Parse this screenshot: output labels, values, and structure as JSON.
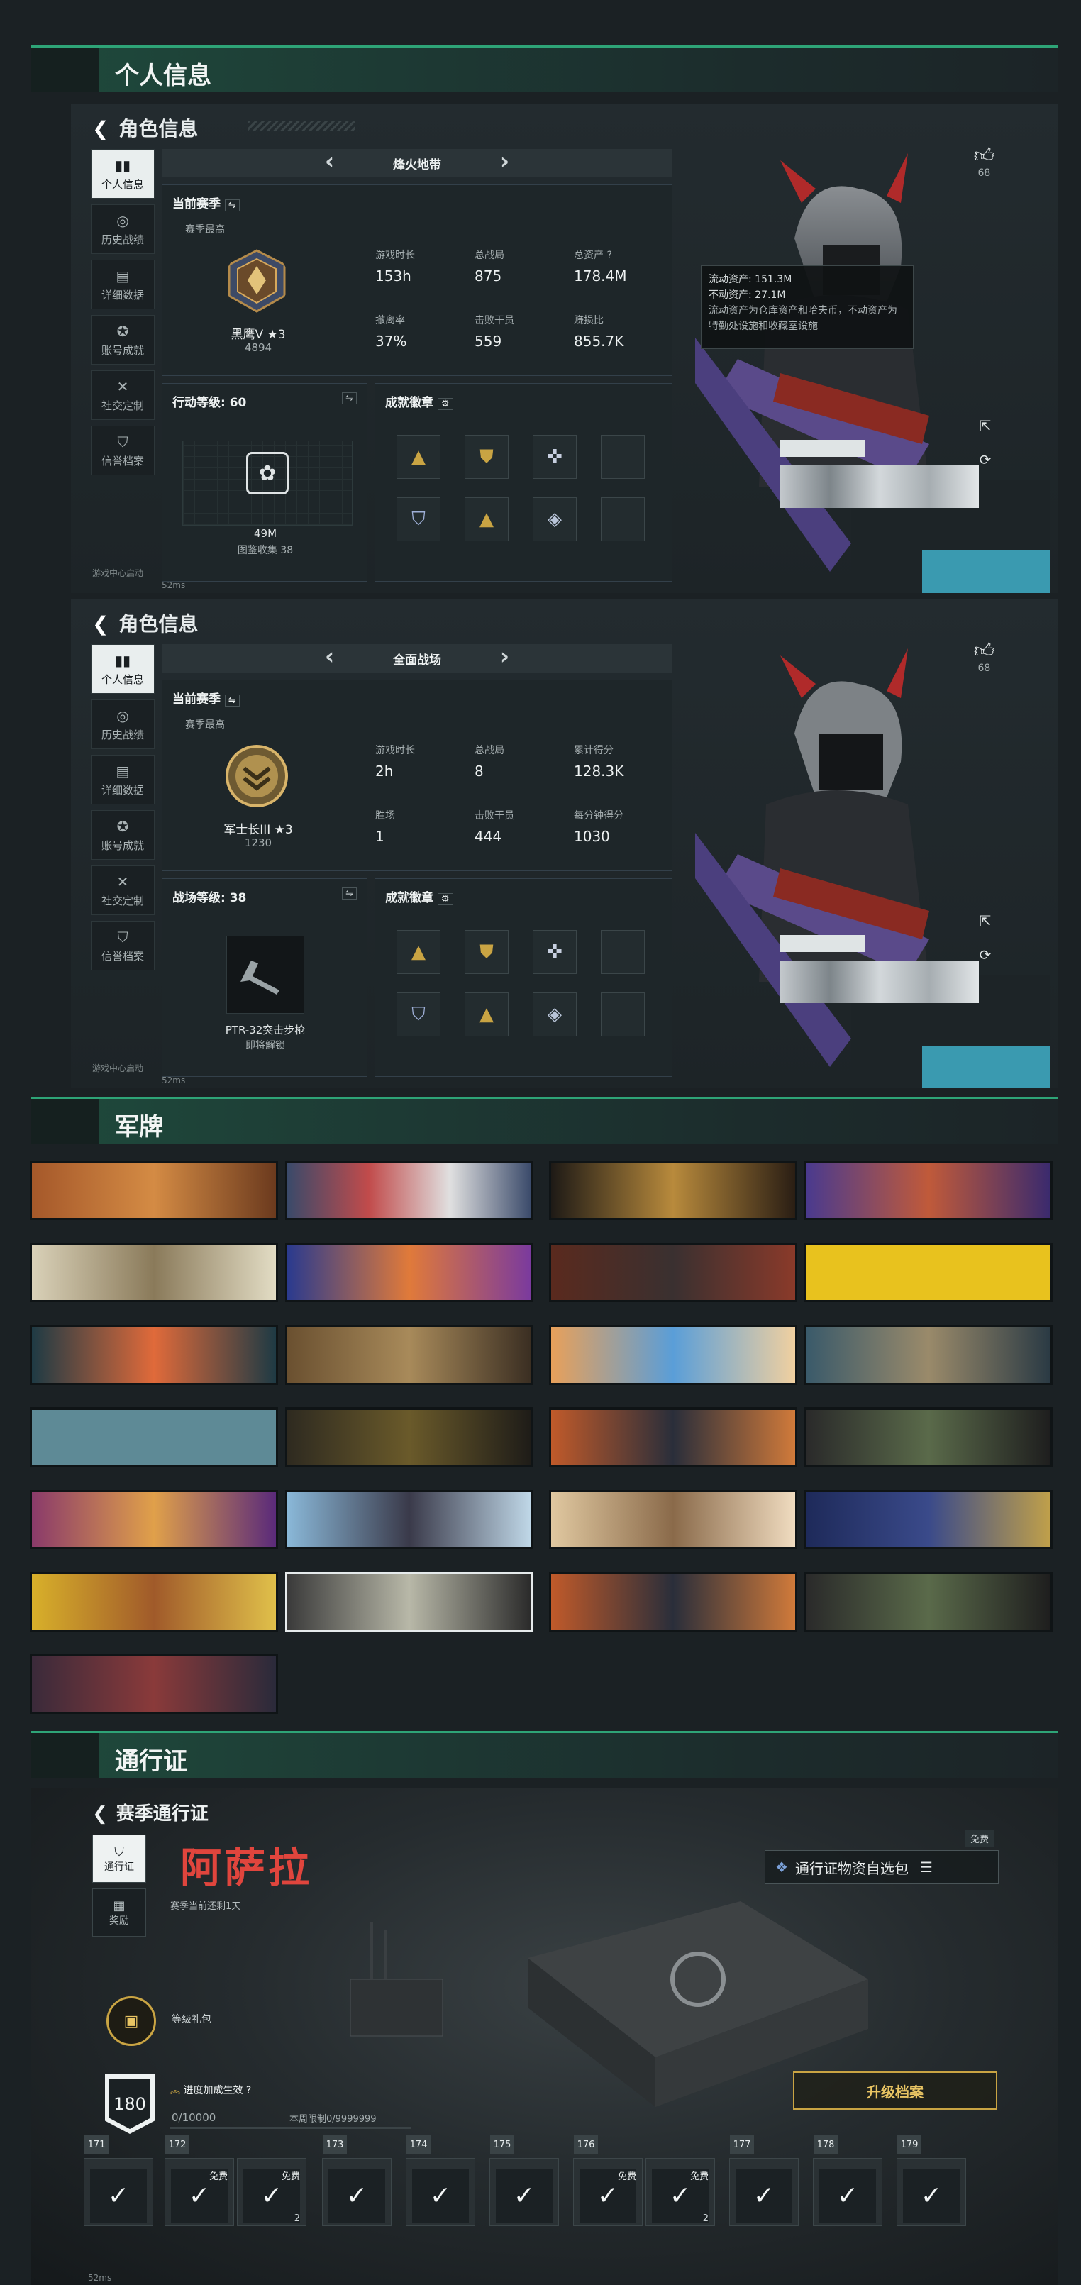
{
  "sections": {
    "personal_info": "个人信息",
    "dog_tags": "军牌",
    "pass": "通行证"
  },
  "panel1": {
    "back_label": "角色信息",
    "mode": "烽火地带",
    "current_season": "当前赛季",
    "season_best": "赛季最高",
    "rank_name": "黑鹰V ★3",
    "rank_score": "4894",
    "stats": [
      {
        "label": "游戏时长",
        "value": "153h"
      },
      {
        "label": "总战局",
        "value": "875"
      },
      {
        "label": "总资产",
        "value": "178.4M"
      },
      {
        "label": "撤离率",
        "value": "37%"
      },
      {
        "label": "击败干员",
        "value": "559"
      },
      {
        "label": "赚损比",
        "value": "855.7K"
      }
    ],
    "asset_help": "?",
    "level_title": "行动等级: 60",
    "collection_value": "49M",
    "collection_label": "图鉴收集",
    "collection_count": "38",
    "achievements_title": "成就徽章",
    "tooltip": {
      "line1": "流动资产: 151.3M",
      "line2": "不动资产: 27.1M",
      "note": "流动资产为仓库资产和哈夫币，不动资产为特勤处设施和收藏室设施"
    },
    "likes": "68",
    "net_info": "52ms"
  },
  "panel2": {
    "back_label": "角色信息",
    "mode": "全面战场",
    "current_season": "当前赛季",
    "season_best": "赛季最高",
    "rank_name": "军士长III ★3",
    "rank_score": "1230",
    "stats": [
      {
        "label": "游戏时长",
        "value": "2h"
      },
      {
        "label": "总战局",
        "value": "8"
      },
      {
        "label": "累计得分",
        "value": "128.3K"
      },
      {
        "label": "胜场",
        "value": "1"
      },
      {
        "label": "击败干员",
        "value": "444"
      },
      {
        "label": "每分钟得分",
        "value": "1030"
      }
    ],
    "level_title": "战场等级: 38",
    "weapon_name": "PTR-32突击步枪",
    "weapon_status": "即将解锁",
    "achievements_title": "成就徽章",
    "likes": "68",
    "net_info": "52ms"
  },
  "nav": {
    "items": [
      "个人信息",
      "历史战绩",
      "详细数据",
      "账号成就",
      "社交定制",
      "信誉档案"
    ],
    "footer": "游戏中心启动"
  },
  "pass": {
    "back_label": "赛季通行证",
    "nav": [
      "通行证",
      "奖励"
    ],
    "season_name": "阿萨拉",
    "season_remaining": "赛季当前还剩1天",
    "free_tag": "免费",
    "pick_button": "通行证物资自选包",
    "level_pack": "等级礼包",
    "level": "180",
    "progress_label": "进度加成生效",
    "progress_help": "?",
    "progress_value": "0/10000",
    "week_limit": "本周限制0/9999999",
    "upgrade_button": "升级档案",
    "slots": [
      {
        "num": "171",
        "free": "",
        "count": ""
      },
      {
        "num": "172",
        "free": "免费",
        "count": ""
      },
      {
        "num": "",
        "free": "免费",
        "count": "2"
      },
      {
        "num": "173",
        "free": "",
        "count": ""
      },
      {
        "num": "174",
        "free": "",
        "count": ""
      },
      {
        "num": "175",
        "free": "",
        "count": ""
      },
      {
        "num": "176",
        "free": "免费",
        "count": ""
      },
      {
        "num": "",
        "free": "免费",
        "count": "2"
      },
      {
        "num": "177",
        "free": "",
        "count": ""
      },
      {
        "num": "178",
        "free": "",
        "count": ""
      },
      {
        "num": "179",
        "free": "",
        "count": ""
      }
    ],
    "net_info": "52ms"
  },
  "colors": {
    "accent_green": "#2ea477",
    "gold": "#c9a443",
    "red_title": "#e0453d"
  }
}
